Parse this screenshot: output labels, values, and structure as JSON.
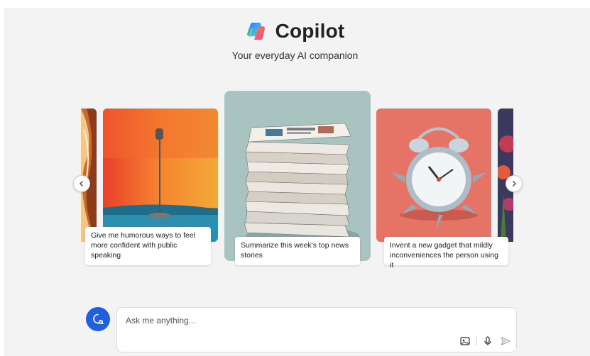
{
  "app": {
    "title": "Copilot",
    "tagline": "Your everyday AI companion"
  },
  "carousel": {
    "prev_icon": "chevron-left-icon",
    "next_icon": "chevron-right-icon",
    "cards": [
      {
        "id": "left-edge",
        "image": "abstract-swirl-art",
        "caption": ""
      },
      {
        "id": "speaking",
        "image": "microphone-stand-painting",
        "caption": "Give me humorous ways to feel more confident with public speaking"
      },
      {
        "id": "news",
        "image": "stack-of-newspapers",
        "caption": "Summarize this week's top news stories"
      },
      {
        "id": "gadget",
        "image": "spiky-alarm-clock",
        "caption": "Invent a new gadget that mildly inconveniences the person using it"
      },
      {
        "id": "right-edge",
        "image": "flowers-art",
        "caption": ""
      }
    ]
  },
  "composer": {
    "placeholder": "Ask me anything...",
    "icons": [
      "new-topic-icon",
      "image-upload-icon",
      "microphone-icon",
      "send-icon"
    ]
  },
  "colors": {
    "accent": "#1f5fe0",
    "background": "#f3f3f3"
  }
}
